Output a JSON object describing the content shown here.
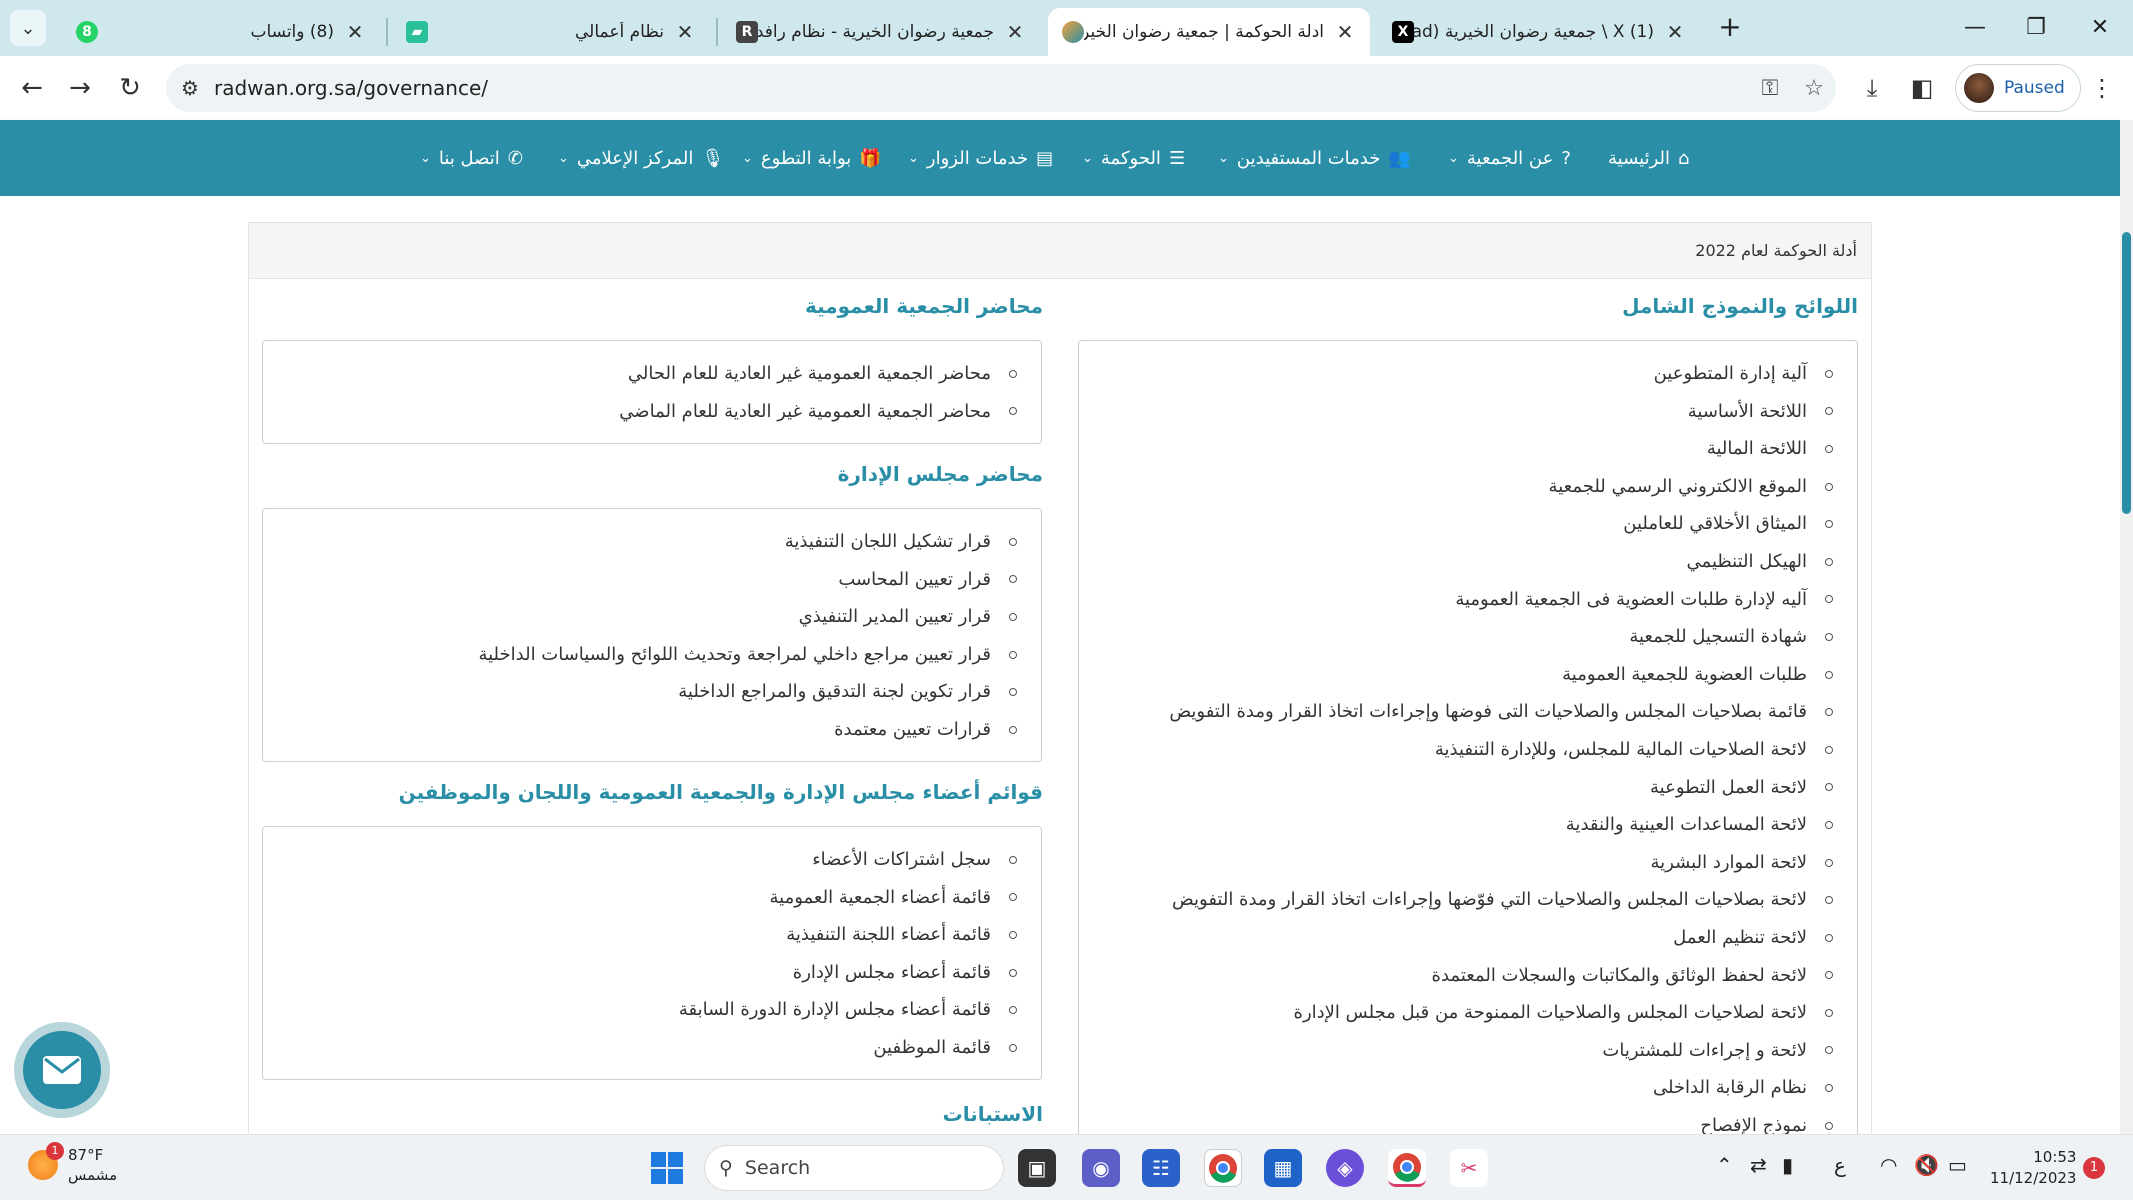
{
  "browser": {
    "tabs": [
      {
        "title": "(8) واتساب",
        "favicon": "whatsapp-icon"
      },
      {
        "title": "نظام أعمالي",
        "favicon": "amali-icon"
      },
      {
        "title": "جمعية رضوان الخيرية - نظام رافد",
        "favicon": "rafed-icon"
      },
      {
        "title": "ادلة الحوكمة | جمعية رضوان الخير",
        "favicon": "radwan-icon",
        "active": true
      },
      {
        "title": "(1) X \\ جمعية رضوان الخيرية (rad",
        "favicon": "x-icon"
      }
    ],
    "url": "radwan.org.sa/governance/",
    "profile_label": "Paused"
  },
  "site_nav": {
    "items": [
      {
        "label": "الرئيسية",
        "icon": "home-icon",
        "has_menu": false
      },
      {
        "label": "عن الجمعية",
        "icon": "question-icon",
        "has_menu": true
      },
      {
        "label": "خدمات المستفيدين",
        "icon": "users-icon",
        "has_menu": true
      },
      {
        "label": "الحوكمة",
        "icon": "list-icon",
        "has_menu": true
      },
      {
        "label": "خدمات الزوار",
        "icon": "table-icon",
        "has_menu": true
      },
      {
        "label": "بوابة التطوع",
        "icon": "gift-icon",
        "has_menu": true
      },
      {
        "label": "المركز الإعلامي",
        "icon": "mic-icon",
        "has_menu": true
      },
      {
        "label": "اتصل بنا",
        "icon": "phone-icon",
        "has_menu": true
      }
    ]
  },
  "panel": {
    "header": "أدلة الحوكمة لعام 2022"
  },
  "sections": {
    "regulations": {
      "title": "اللوائح والنموذج الشامل",
      "items": [
        "آلية إدارة المتطوعين",
        "اللائحة الأساسية",
        "اللائحة المالية",
        "الموقع الالكتروني الرسمي للجمعية",
        "الميثاق الأخلاقي للعاملين",
        "الهيكل التنظيمي",
        "آليه لإدارة طلبات العضوية فى الجمعية العمومية",
        "شهادة التسجيل للجمعية",
        "طلبات العضوية للجمعية العمومية",
        "قائمة بصلاحيات المجلس والصلاحيات التى فوضها وإجراءات اتخاذ القرار ومدة التفويض",
        "لائحة الصلاحيات المالية للمجلس، وللإدارة التنفيذية",
        "لائحة العمل التطوعية",
        "لائحة المساعدات العينية والنقدية",
        "لائحة الموارد البشرية",
        "لائحة بصلاحيات المجلس والصلاحيات التي فوّضها وإجراءات اتخاذ القرار ومدة التفويض",
        "لائحة تنظيم العمل",
        "لائحة لحفظ الوثائق والمكاتبات والسجلات المعتمدة",
        "لائحة لصلاحيات المجلس والصلاحيات الممنوحة من قبل مجلس الإدارة",
        "لائحة و إجراءات للمشتريات",
        "نظام الرقابة الداخلى",
        "نموذج الإفصاح"
      ]
    },
    "general_assembly": {
      "title": "محاضر الجمعية العمومية",
      "items": [
        "محاضر الجمعية العمومية غير العادية للعام الحالي",
        "محاضر الجمعية العمومية غير العادية للعام الماضي"
      ]
    },
    "board_minutes": {
      "title": "محاضر مجلس الإدارة",
      "items": [
        "قرار تشكيل اللجان التنفيذية",
        "قرار تعيين المحاسب",
        "قرار تعيين المدير التنفيذي",
        "قرار تعيين مراجع داخلي لمراجعة وتحديث اللوائح والسياسات الداخلية",
        "قرار تكوين لجنة التدقيق والمراجع الداخلية",
        "قرارات تعيين معتمدة"
      ]
    },
    "member_lists": {
      "title": "قوائم أعضاء مجلس الإدارة والجمعية العمومية واللجان والموظفين",
      "items": [
        "سجل اشتراكات الأعضاء",
        "قائمة أعضاء الجمعية العمومية",
        "قائمة أعضاء اللجنة التنفيذية",
        "قائمة أعضاء مجلس الإدارة",
        "قائمة أعضاء مجلس الإدارة الدورة السابقة",
        "قائمة الموظفين"
      ]
    },
    "surveys": {
      "title": "الاستبانات"
    }
  },
  "taskbar": {
    "weather_temp": "87°F",
    "weather_desc": "مشمس",
    "weather_badge": "1",
    "search_placeholder": "Search",
    "lang": "ع",
    "time": "10:53",
    "date": "11/12/2023",
    "notif_count": "1"
  },
  "colors": {
    "brand": "#2a8fa6",
    "tabstrip": "#cfe8ee"
  }
}
